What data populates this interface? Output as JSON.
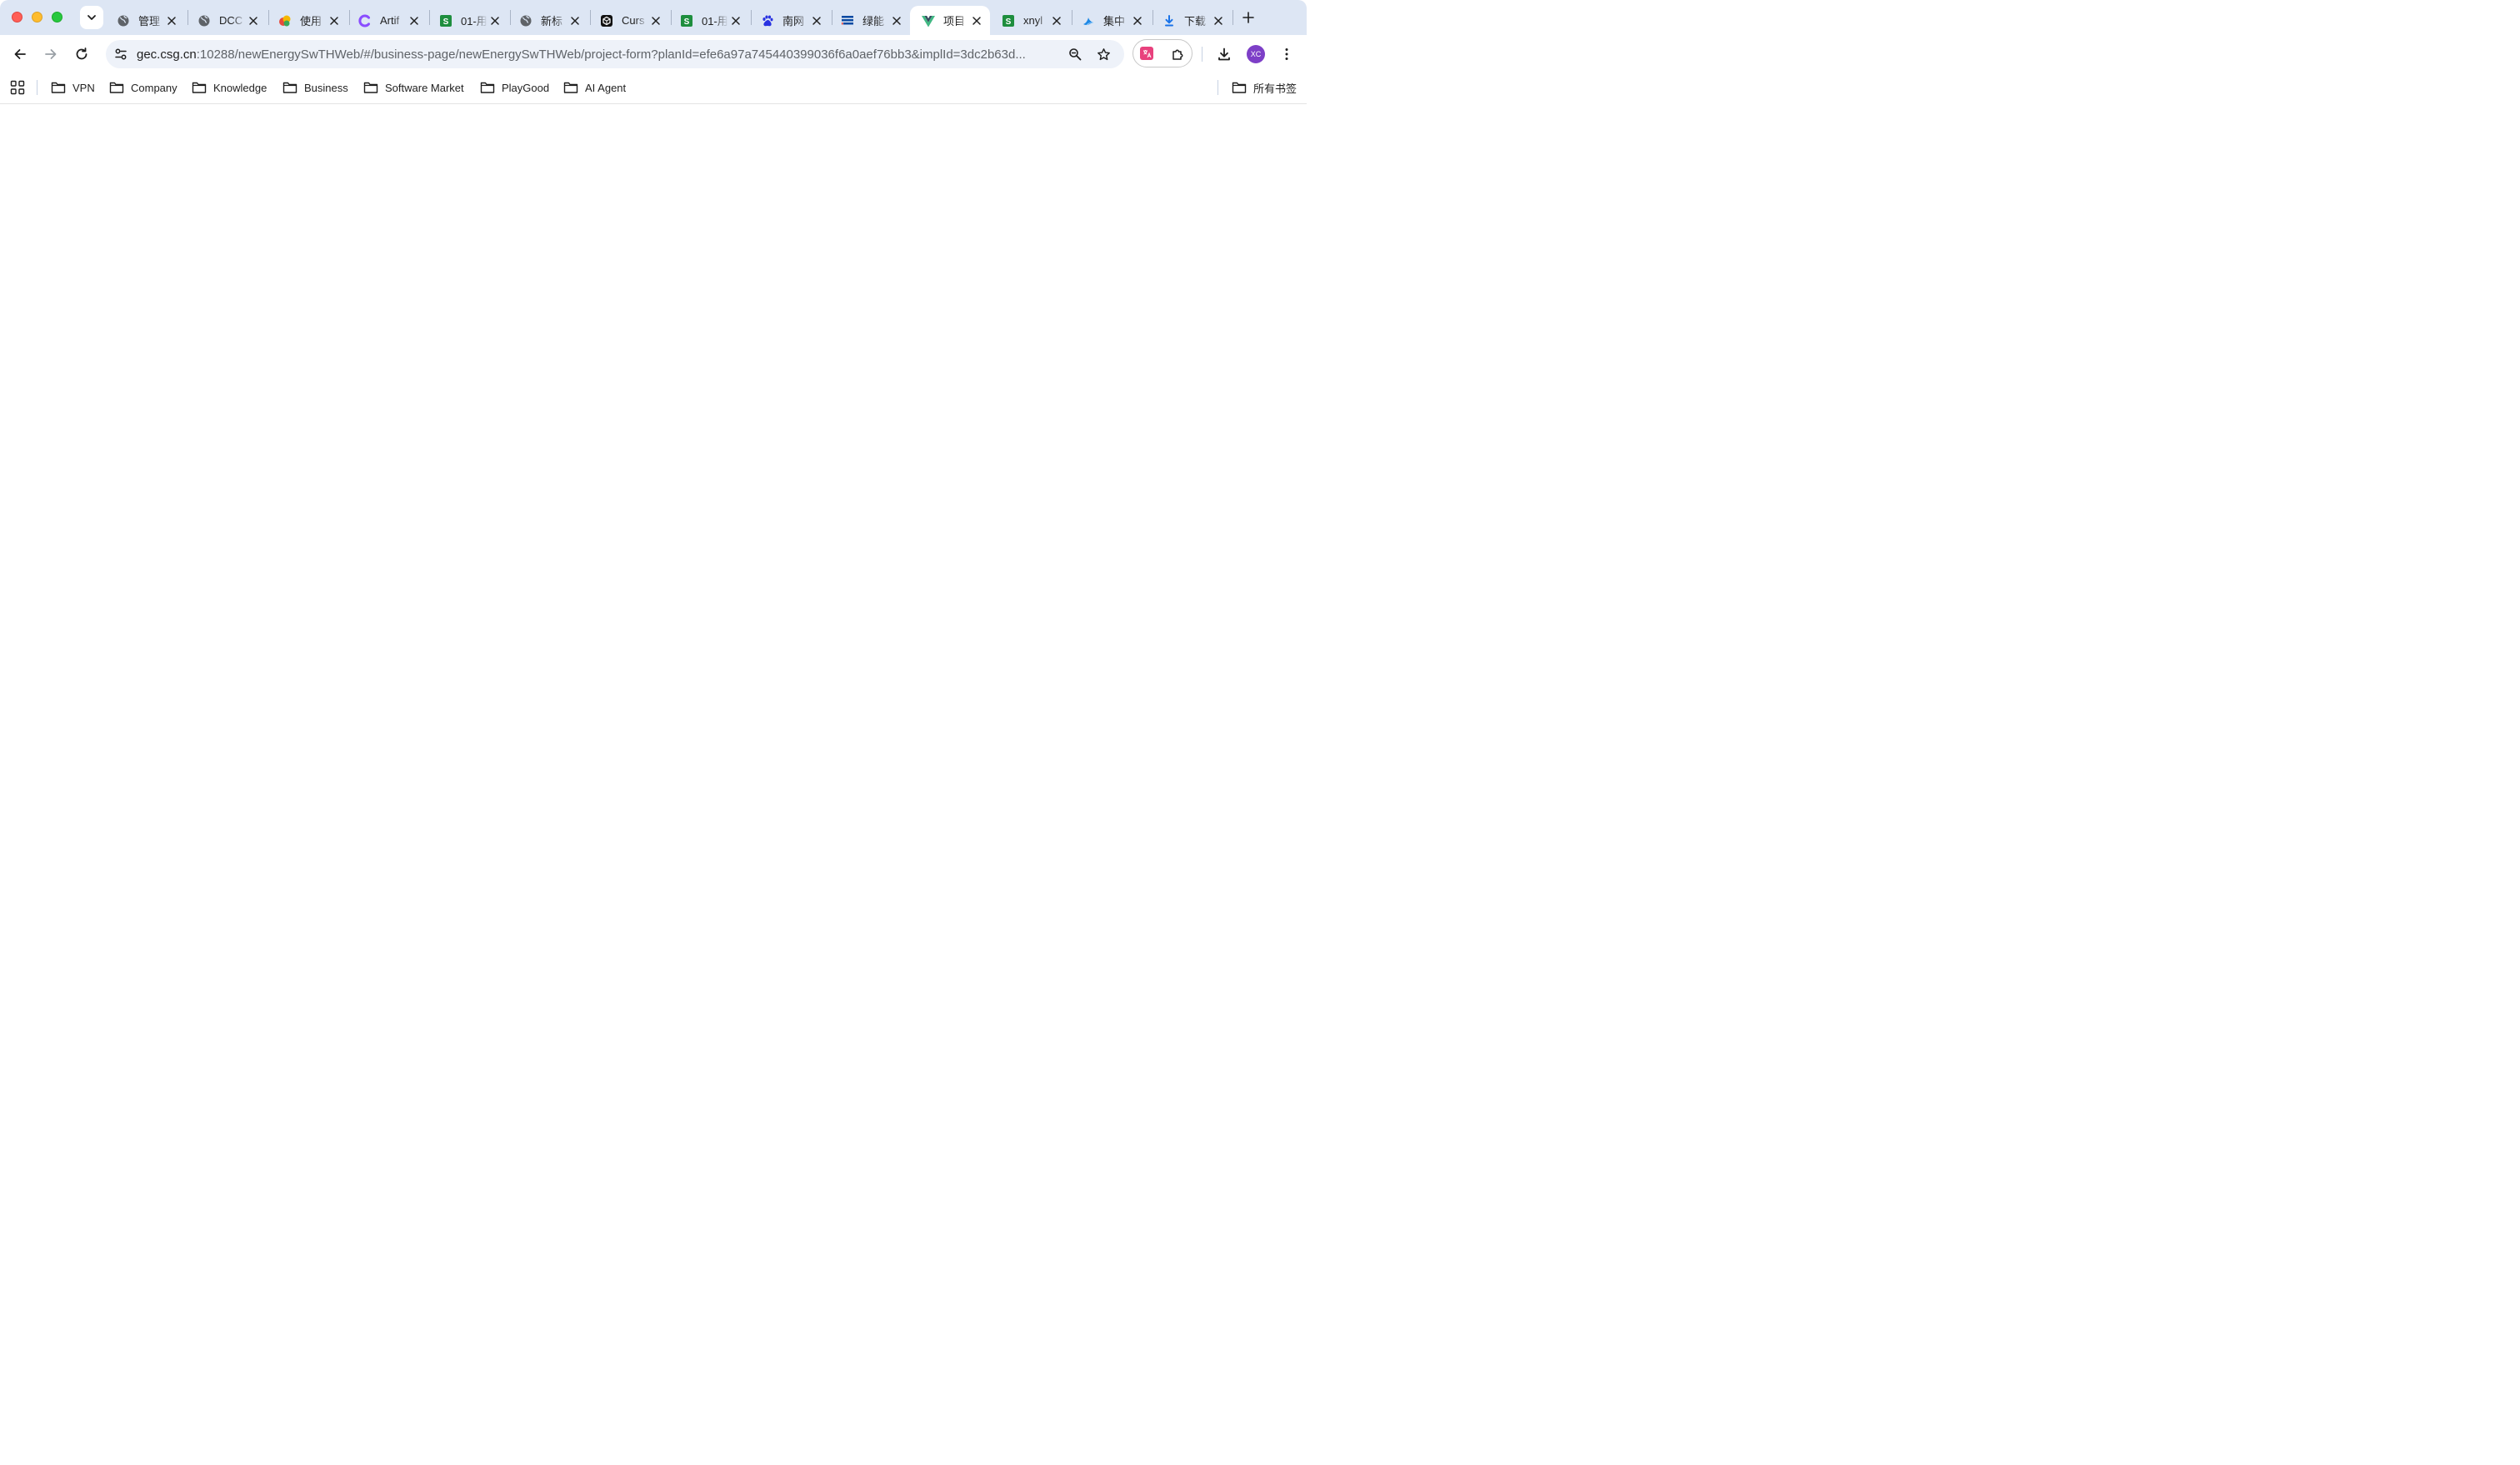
{
  "tabs": [
    {
      "title": "管理",
      "icon": "globe-icon"
    },
    {
      "title": "DCC",
      "icon": "globe-icon"
    },
    {
      "title": "使用",
      "icon": "colorful-blob-icon"
    },
    {
      "title": "Artif",
      "icon": "c-logo-icon"
    },
    {
      "title": "01-用",
      "icon": "sheets-icon"
    },
    {
      "title": "新标",
      "icon": "globe-icon"
    },
    {
      "title": "Curs",
      "icon": "cursor-logo-icon"
    },
    {
      "title": "01-用",
      "icon": "sheets-icon"
    },
    {
      "title": "南网",
      "icon": "baidu-paw-icon"
    },
    {
      "title": "绿能",
      "icon": "stripes-logo-icon"
    },
    {
      "title": "项目",
      "icon": "vue-logo-icon",
      "active": true
    },
    {
      "title": "xnyl",
      "icon": "sheets-icon"
    },
    {
      "title": "集中",
      "icon": "bird-logo-icon"
    },
    {
      "title": "下载",
      "icon": "download-icon"
    }
  ],
  "address_bar": {
    "host": "gec.csg.cn",
    "rest": ":10288/newEnergySwTHWeb/#/business-page/newEnergySwTHWeb/project-form?planId=efe6a97a745440399036f6a0aef76bb3&implId=3dc2b63d..."
  },
  "profile": {
    "initials": "XC",
    "color": "#7d3fc7"
  },
  "bookmarks": [
    {
      "label": "VPN"
    },
    {
      "label": "Company"
    },
    {
      "label": "Knowledge"
    },
    {
      "label": "Business"
    },
    {
      "label": "Software Market"
    },
    {
      "label": "PlayGood"
    },
    {
      "label": "AI Agent"
    }
  ],
  "all_bookmarks_label": "所有书签",
  "colors": {
    "tab_strip": "#dde6f4",
    "omnibox": "#eef2f9",
    "translate_ext": "#e8417d"
  }
}
